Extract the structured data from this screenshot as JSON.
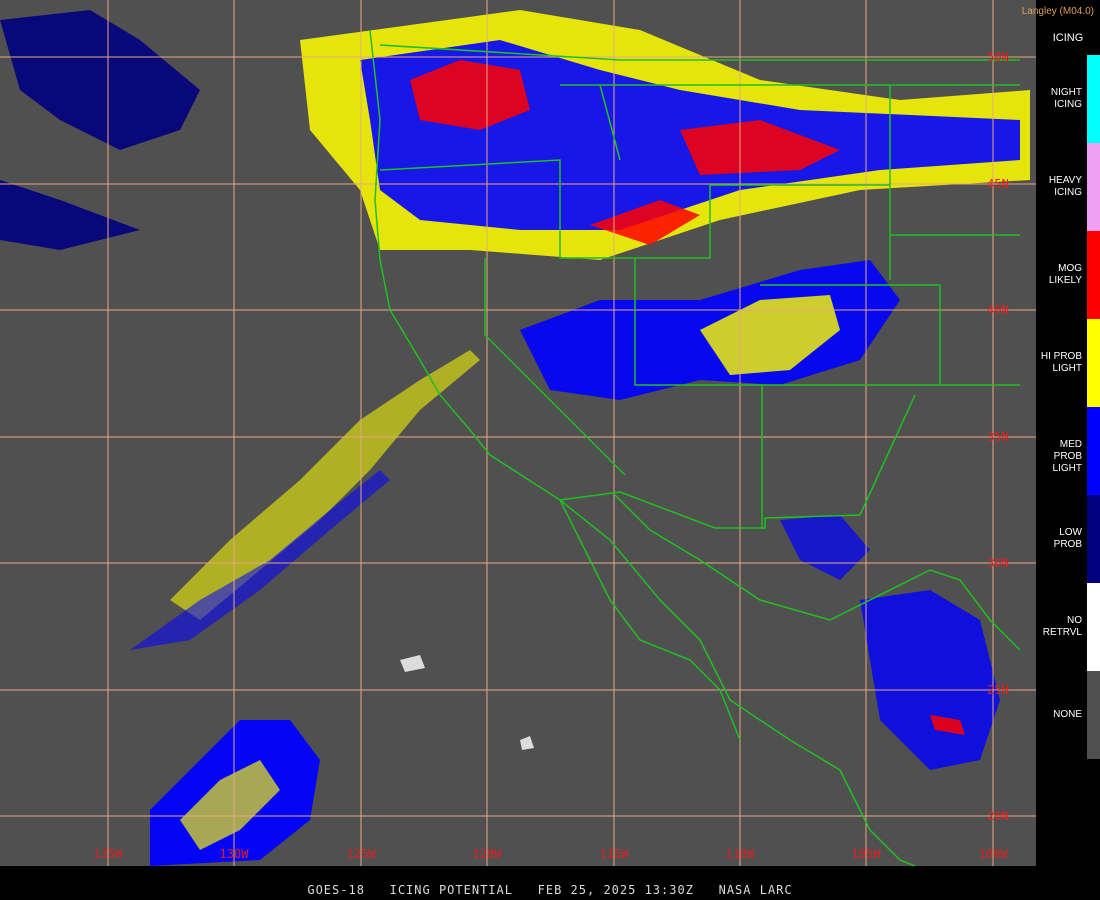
{
  "header": {
    "source_label": "Langley (M04.0)"
  },
  "footer": {
    "caption": "GOES-18   ICING POTENTIAL   FEB 25, 2025 13:30Z   NASA LARC"
  },
  "legend": {
    "title": "ICING",
    "items": [
      {
        "label": "NIGHT\nICING",
        "color": "#00ffff"
      },
      {
        "label": "HEAVY\nICING",
        "color": "#f0a0f0"
      },
      {
        "label": "MOG\nLIKELY",
        "color": "#ff0000"
      },
      {
        "label": "HI PROB\nLIGHT",
        "color": "#ffff00"
      },
      {
        "label": "MED PROB\nLIGHT",
        "color": "#0000ff"
      },
      {
        "label": "LOW\nPROB",
        "color": "#000080"
      },
      {
        "label": "NO\nRETRVL",
        "color": "#ffffff"
      },
      {
        "label": "NONE",
        "color": "#505050"
      }
    ]
  },
  "map": {
    "background_color": "#505050",
    "grid_color": "#e8a880",
    "border_color": "#20c020",
    "latitude_labels": [
      "50N",
      "45N",
      "40N",
      "35N",
      "30N",
      "25N",
      "20N"
    ],
    "longitude_labels": [
      "135W",
      "130W",
      "125W",
      "120W",
      "115W",
      "110W",
      "105W",
      "100W"
    ]
  }
}
